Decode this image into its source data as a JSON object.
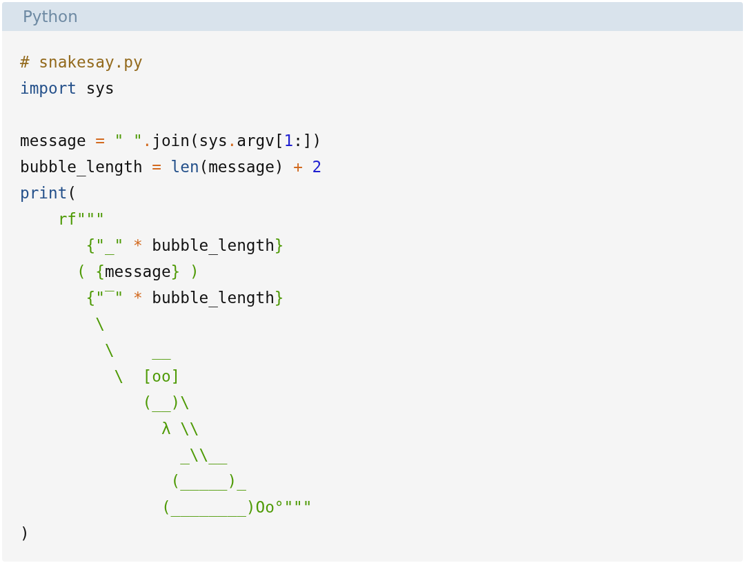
{
  "header": {
    "language": "Python"
  },
  "code_lines": [
    {
      "kind": "code",
      "tokens": [
        {
          "kind": "comment",
          "text": "# snakesay.py"
        }
      ]
    },
    {
      "kind": "code",
      "tokens": [
        {
          "kind": "keyword",
          "text": "import"
        },
        {
          "kind": "plain",
          "text": " sys"
        }
      ]
    },
    {
      "kind": "blank"
    },
    {
      "kind": "code",
      "tokens": [
        {
          "kind": "plain",
          "text": "message "
        },
        {
          "kind": "operator",
          "text": "= "
        },
        {
          "kind": "string",
          "text": "\" \""
        },
        {
          "kind": "operator",
          "text": "."
        },
        {
          "kind": "plain",
          "text": "join(sys"
        },
        {
          "kind": "operator",
          "text": "."
        },
        {
          "kind": "plain",
          "text": "argv["
        },
        {
          "kind": "number",
          "text": "1"
        },
        {
          "kind": "plain",
          "text": ":])"
        }
      ]
    },
    {
      "kind": "code",
      "tokens": [
        {
          "kind": "plain",
          "text": "bubble_length "
        },
        {
          "kind": "operator",
          "text": "= "
        },
        {
          "kind": "keyword",
          "text": "len"
        },
        {
          "kind": "plain",
          "text": "(message) "
        },
        {
          "kind": "operator",
          "text": "+ "
        },
        {
          "kind": "number",
          "text": "2"
        }
      ]
    },
    {
      "kind": "code",
      "tokens": [
        {
          "kind": "keyword",
          "text": "print"
        },
        {
          "kind": "plain",
          "text": "("
        }
      ]
    },
    {
      "kind": "code",
      "tokens": [
        {
          "kind": "string",
          "text": "    rf\"\"\""
        }
      ]
    },
    {
      "kind": "code",
      "tokens": [
        {
          "kind": "string",
          "text": "       {\"_\" "
        },
        {
          "kind": "operator",
          "text": "*"
        },
        {
          "kind": "plain",
          "text": " bubble_length"
        },
        {
          "kind": "string",
          "text": "}"
        }
      ]
    },
    {
      "kind": "code",
      "tokens": [
        {
          "kind": "string",
          "text": "      ( {"
        },
        {
          "kind": "plain",
          "text": "message"
        },
        {
          "kind": "string",
          "text": "} )"
        }
      ]
    },
    {
      "kind": "code",
      "tokens": [
        {
          "kind": "string",
          "text": "       {\"‾\" "
        },
        {
          "kind": "operator",
          "text": "*"
        },
        {
          "kind": "plain",
          "text": " bubble_length"
        },
        {
          "kind": "string",
          "text": "}"
        }
      ]
    },
    {
      "kind": "code",
      "tokens": [
        {
          "kind": "string",
          "text": "        \\"
        }
      ]
    },
    {
      "kind": "code",
      "tokens": [
        {
          "kind": "string",
          "text": "         \\    __"
        }
      ]
    },
    {
      "kind": "code",
      "tokens": [
        {
          "kind": "string",
          "text": "          \\  [oo]"
        }
      ]
    },
    {
      "kind": "code",
      "tokens": [
        {
          "kind": "string",
          "text": "             (__)\\"
        }
      ]
    },
    {
      "kind": "code",
      "tokens": [
        {
          "kind": "string",
          "text": "               λ \\\\"
        }
      ]
    },
    {
      "kind": "code",
      "tokens": [
        {
          "kind": "string",
          "text": "                 _\\\\__"
        }
      ]
    },
    {
      "kind": "code",
      "tokens": [
        {
          "kind": "string",
          "text": "                (_____)_"
        }
      ]
    },
    {
      "kind": "code",
      "tokens": [
        {
          "kind": "string",
          "text": "               (________)Oo°\"\"\""
        }
      ]
    },
    {
      "kind": "code",
      "tokens": [
        {
          "kind": "plain",
          "text": ")"
        }
      ]
    }
  ]
}
